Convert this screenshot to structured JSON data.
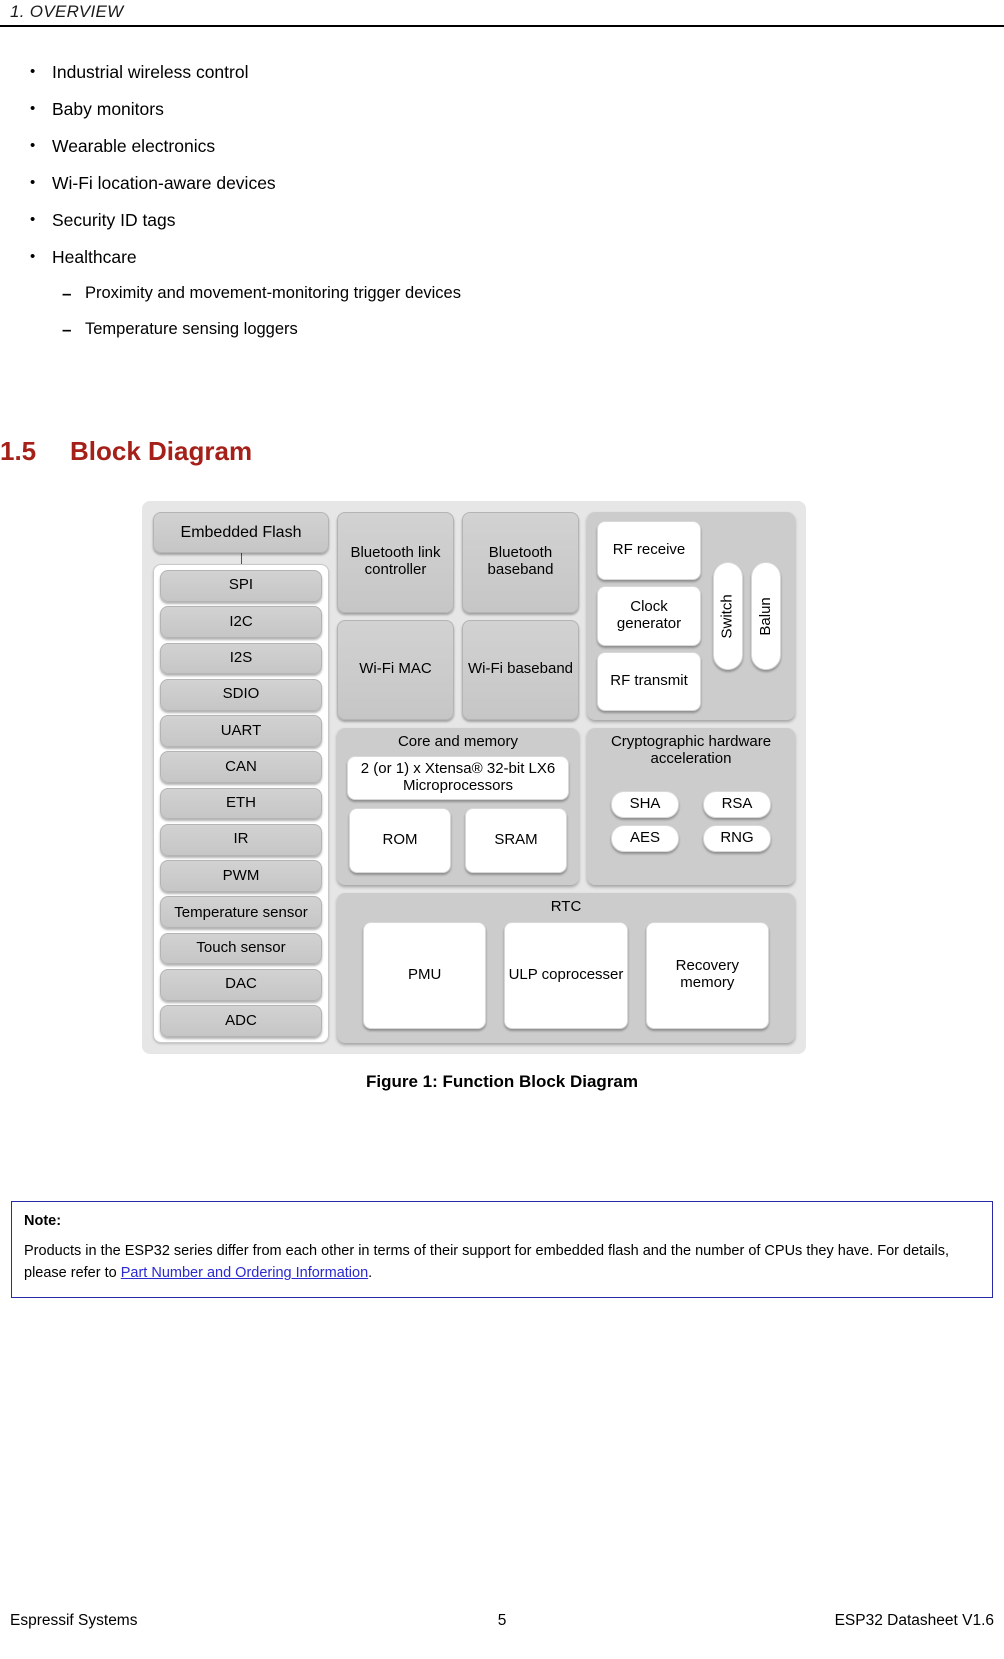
{
  "header": {
    "running_head": "1.  OVERVIEW"
  },
  "bullets": [
    {
      "text": "Industrial wireless control"
    },
    {
      "text": "Baby monitors"
    },
    {
      "text": "Wearable electronics"
    },
    {
      "text": "Wi-Fi location-aware devices"
    },
    {
      "text": "Security ID tags"
    },
    {
      "text": "Healthcare"
    }
  ],
  "sub_bullets": [
    {
      "text": "Proximity and movement-monitoring trigger devices"
    },
    {
      "text": "Temperature sensing loggers"
    }
  ],
  "bullet_marker": "•",
  "sub_marker": "–",
  "section": {
    "number": "1.5",
    "title": "Block Diagram",
    "color": "#a52019"
  },
  "diagram": {
    "embedded_flash": "Embedded Flash",
    "peripherals": [
      "SPI",
      "I2C",
      "I2S",
      "SDIO",
      "UART",
      "CAN",
      "ETH",
      "IR",
      "PWM",
      "Temperature sensor",
      "Touch sensor",
      "DAC",
      "ADC"
    ],
    "radio": [
      "Bluetooth link controller",
      "Bluetooth baseband",
      "Wi-Fi MAC",
      "Wi-Fi baseband"
    ],
    "rf": {
      "blocks": [
        "RF receive",
        "Clock generator",
        "RF transmit"
      ],
      "vertical": [
        "Switch",
        "Balun"
      ]
    },
    "core": {
      "title": "Core and memory",
      "cpu": "2 (or 1) x Xtensa® 32-bit LX6 Microprocessors",
      "memories": [
        "ROM",
        "SRAM"
      ]
    },
    "crypto": {
      "title": "Cryptographic hardware acceleration",
      "blocks": [
        "SHA",
        "RSA",
        "AES",
        "RNG"
      ]
    },
    "rtc": {
      "title": "RTC",
      "blocks": [
        "PMU",
        "ULP coprocesser",
        "Recovery memory"
      ]
    }
  },
  "figure": {
    "caption": "Figure 1: Function Block Diagram"
  },
  "note": {
    "title": "Note:",
    "text_before": "Products in the ESP32 series differ from each other in terms of their support for embedded flash and the number of CPUs they have. For details, please refer to ",
    "link": "Part Number and Ordering Information",
    "text_after": "."
  },
  "footer": {
    "left": "Espressif Systems",
    "page": "5",
    "right": "ESP32 Datasheet V1.6"
  }
}
